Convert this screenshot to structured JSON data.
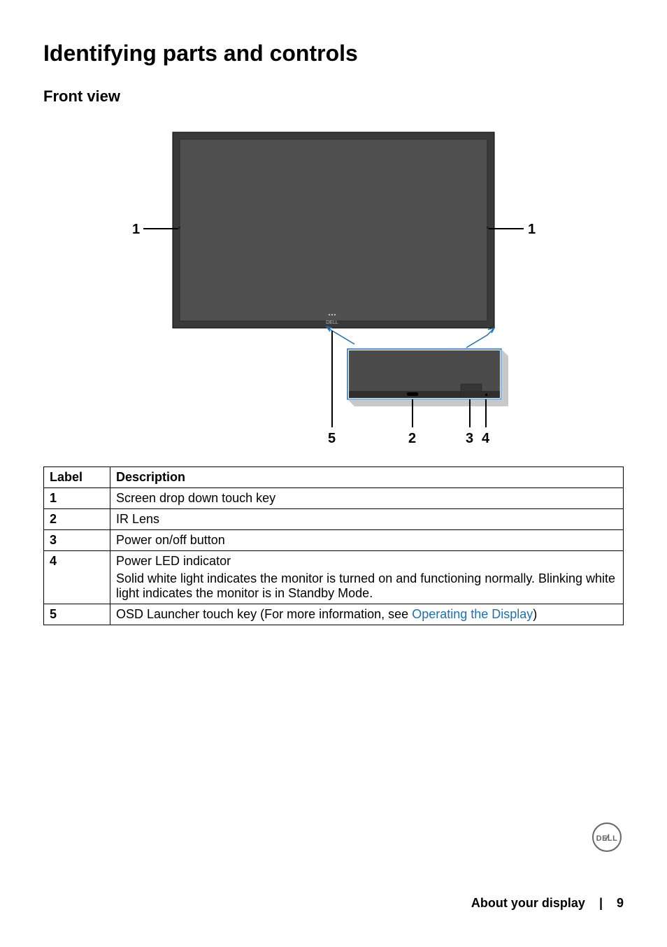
{
  "section_title": "Identifying parts and controls",
  "sub_title": "Front view",
  "table": {
    "header_label": "Label",
    "header_desc": "Description",
    "rows": [
      {
        "label": "1",
        "desc": "Screen drop down touch key"
      },
      {
        "label": "2",
        "desc": "IR Lens"
      },
      {
        "label": "3",
        "desc": "Power on/off button"
      },
      {
        "label": "4",
        "desc": "Power LED  indicator",
        "desc_extra": "Solid white light indicates the monitor is turned on and functioning normally. Blinking white light indicates the monitor is in Standby Mode."
      },
      {
        "label": "5",
        "desc_prefix": "OSD Launcher touch key (For more information, see ",
        "desc_link": "Operating the Display",
        "desc_suffix": ")"
      }
    ]
  },
  "diagram": {
    "callouts": {
      "left1": "1",
      "right1": "1",
      "c2": "2",
      "c3": "3",
      "c4": "4",
      "c5": "5"
    }
  },
  "footer": {
    "section": "About your display",
    "separator": "|",
    "page_number": "9"
  },
  "brand_logo_text": "DELL"
}
